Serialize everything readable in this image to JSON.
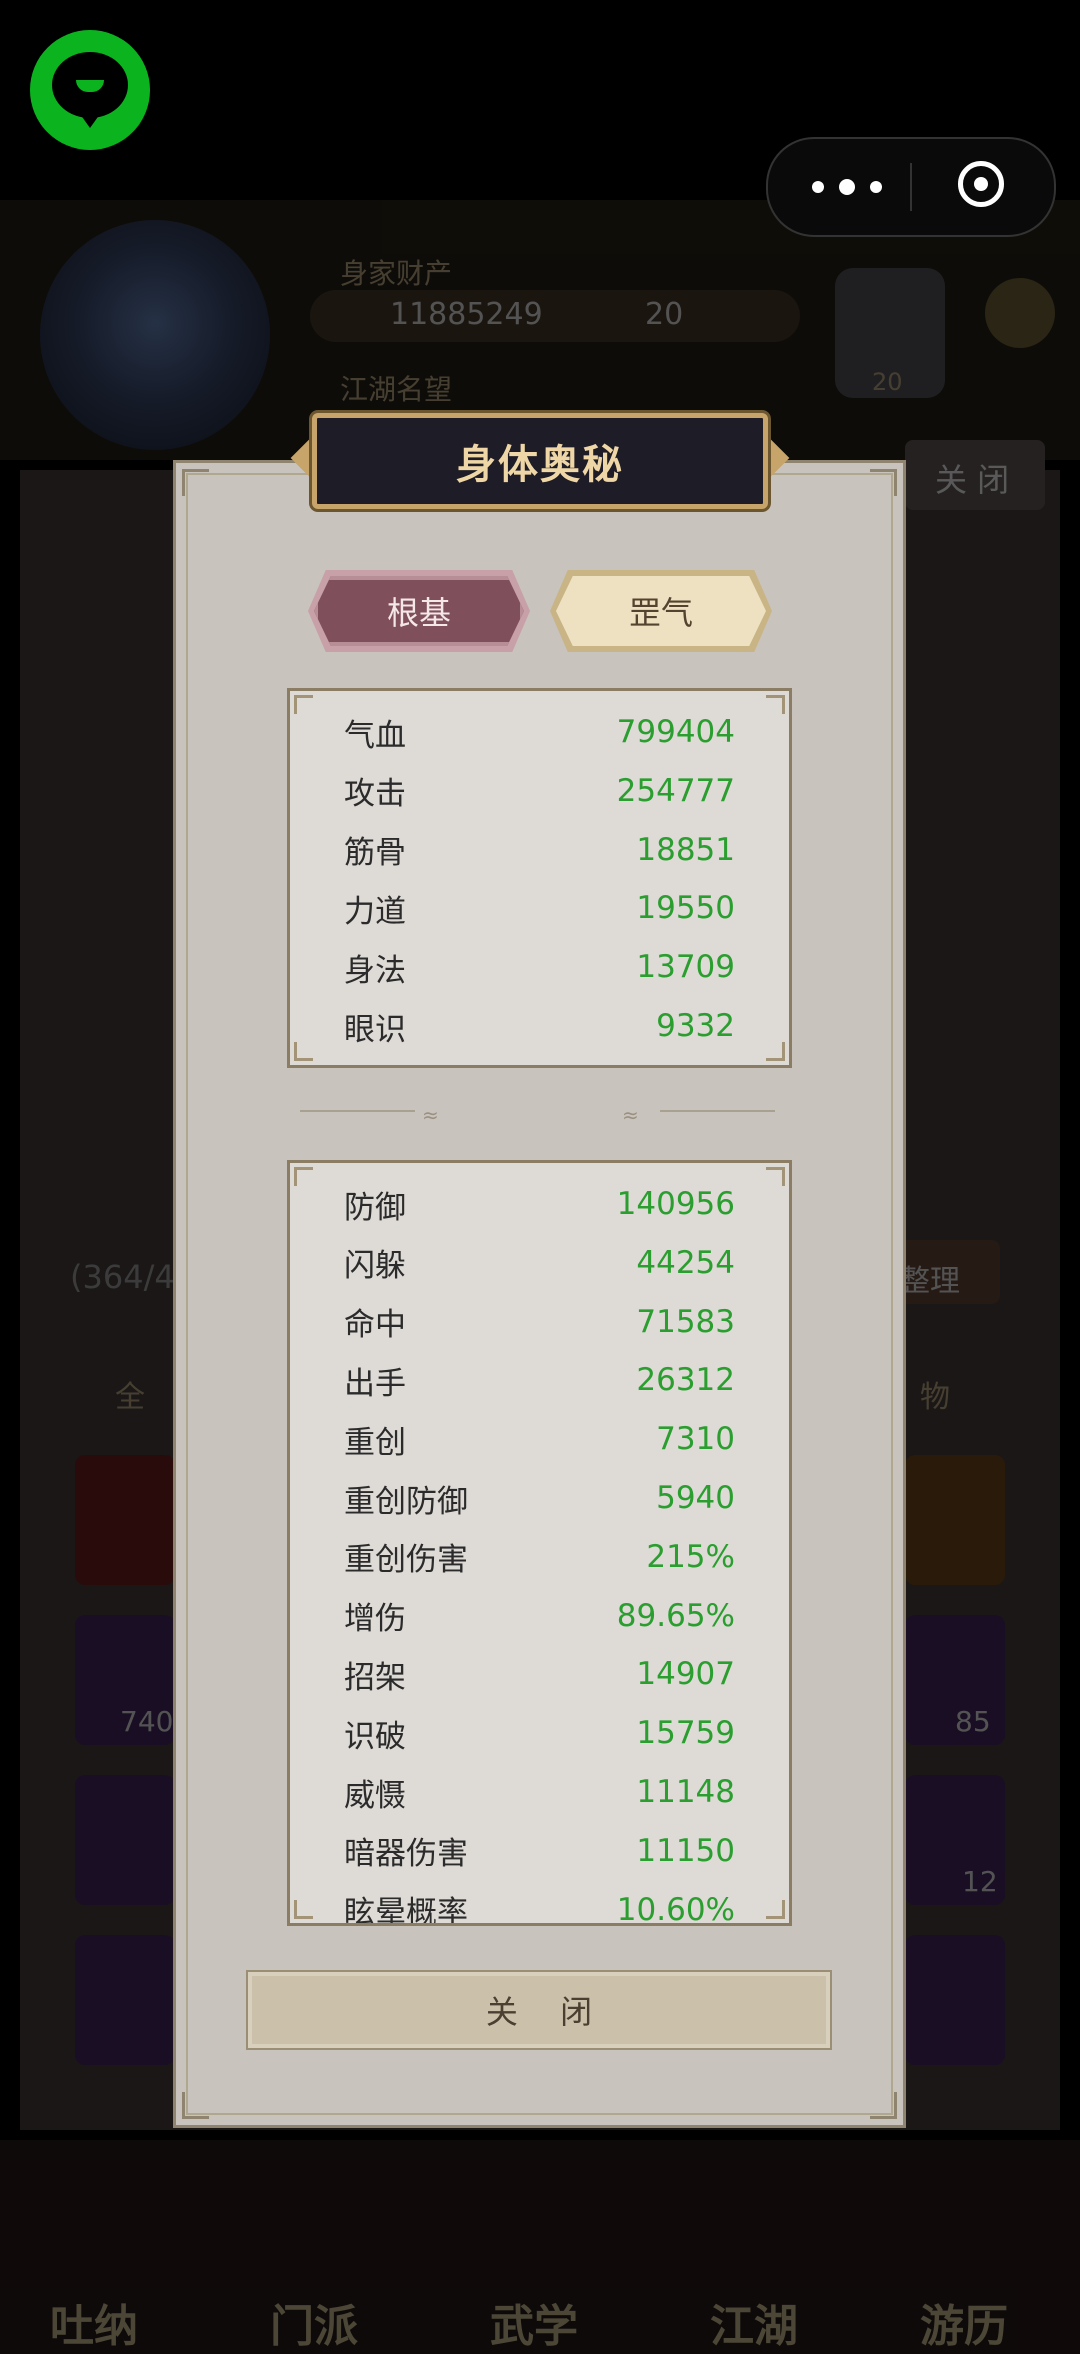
{
  "background": {
    "wealth_title": "身家财产",
    "gold": "11885249",
    "jade": "20",
    "fame_title": "江湖名望",
    "yinyang_count": "20",
    "close_label": "关 闭",
    "capacity": "(364/4",
    "tab_all": "全",
    "tab_item": "物",
    "sort_label": "整理",
    "slot_counts": [
      "740",
      "85",
      "12"
    ],
    "nav": [
      "吐纳",
      "门派",
      "武学",
      "江湖",
      "游历"
    ]
  },
  "modal": {
    "title": "身体奥秘",
    "tabs": [
      {
        "label": "根基",
        "active": true
      },
      {
        "label": "罡气",
        "active": false
      }
    ],
    "basic_stats": [
      {
        "name": "气血",
        "value": "799404"
      },
      {
        "name": "攻击",
        "value": "254777"
      },
      {
        "name": "筋骨",
        "value": "18851"
      },
      {
        "name": "力道",
        "value": "19550"
      },
      {
        "name": "身法",
        "value": "13709"
      },
      {
        "name": "眼识",
        "value": "9332"
      }
    ],
    "advanced_stats": [
      {
        "name": "防御",
        "value": "140956"
      },
      {
        "name": "闪躲",
        "value": "44254"
      },
      {
        "name": "命中",
        "value": "71583"
      },
      {
        "name": "出手",
        "value": "26312"
      },
      {
        "name": "重创",
        "value": "7310"
      },
      {
        "name": "重创防御",
        "value": "5940"
      },
      {
        "name": "重创伤害",
        "value": "215%"
      },
      {
        "name": "增伤",
        "value": "89.65%"
      },
      {
        "name": "招架",
        "value": "14907"
      },
      {
        "name": "识破",
        "value": "15759"
      },
      {
        "name": "威慑",
        "value": "11148"
      },
      {
        "name": "暗器伤害",
        "value": "11150"
      },
      {
        "name": "眩晕概率",
        "value": "10.60%"
      }
    ],
    "close_button": "关 闭"
  },
  "colors": {
    "stat_value": "#2a9e2f",
    "tab_active": "#7f4f5b",
    "tab_inactive": "#eee1c2",
    "title_plate": "#1e1c26",
    "logo": "#0bb41f"
  }
}
